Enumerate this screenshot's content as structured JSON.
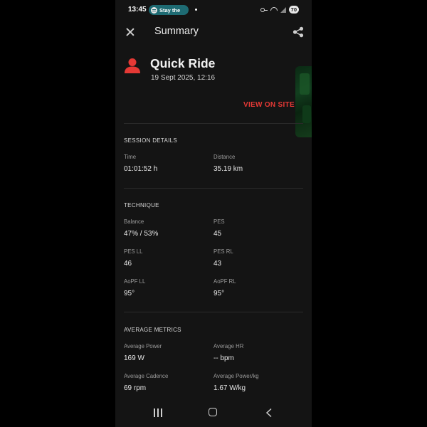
{
  "status_bar": {
    "time": "13:45",
    "media_pill": "Stay the",
    "battery": "70"
  },
  "app_bar": {
    "title": "Summary"
  },
  "ride": {
    "title": "Quick Ride",
    "date": "19 Sept 2025, 12:16",
    "view_link": "VIEW ON SITE",
    "accent_color": "#e53935"
  },
  "sections": {
    "session": {
      "title": "SESSION DETAILS",
      "fields": [
        {
          "label": "Time",
          "value": "01:01:52 h"
        },
        {
          "label": "Distance",
          "value": "35.19 km"
        }
      ]
    },
    "technique": {
      "title": "TECHNIQUE",
      "fields": [
        {
          "label": "Balance",
          "value": "47% / 53%"
        },
        {
          "label": "PES",
          "value": "45"
        },
        {
          "label": "PES LL",
          "value": "46"
        },
        {
          "label": "PES RL",
          "value": "43"
        },
        {
          "label": "AoPF LL",
          "value": "95°"
        },
        {
          "label": "AoPF RL",
          "value": "95°"
        }
      ]
    },
    "average": {
      "title": "AVERAGE METRICS",
      "fields": [
        {
          "label": "Average Power",
          "value": "169 W"
        },
        {
          "label": "Average HR",
          "value": "-- bpm"
        },
        {
          "label": "Average Cadence",
          "value": "69 rpm"
        },
        {
          "label": "Average Power/kg",
          "value": "1.67 W/kg"
        }
      ]
    }
  }
}
